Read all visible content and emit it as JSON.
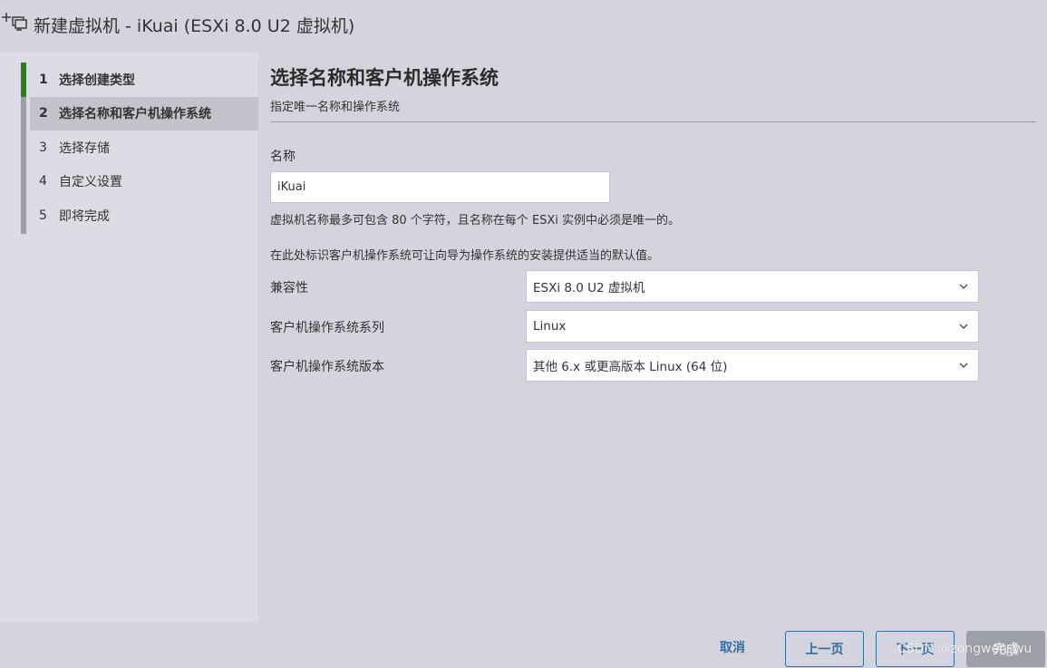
{
  "window": {
    "title": "新建虚拟机 - iKuai (ESXi 8.0 U2 虚拟机)",
    "icon": "new-vm-icon"
  },
  "steps": [
    {
      "num": "1",
      "label": "选择创建类型",
      "state": "done"
    },
    {
      "num": "2",
      "label": "选择名称和客户机操作系统",
      "state": "active"
    },
    {
      "num": "3",
      "label": "选择存储",
      "state": "pending"
    },
    {
      "num": "4",
      "label": "自定义设置",
      "state": "pending"
    },
    {
      "num": "5",
      "label": "即将完成",
      "state": "pending"
    }
  ],
  "page": {
    "title": "选择名称和客户机操作系统",
    "subtitle": "指定唯一名称和操作系统"
  },
  "name_field": {
    "label": "名称",
    "value": "iKuai",
    "hint": "虚拟机名称最多可包含 80 个字符，且名称在每个 ESXi 实例中必须是唯一的。"
  },
  "guest_hint": "在此处标识客户机操作系统可让向导为操作系统的安装提供适当的默认值。",
  "fields": [
    {
      "label": "兼容性",
      "value": "ESXi 8.0 U2 虚拟机"
    },
    {
      "label": "客户机操作系统系列",
      "value": "Linux"
    },
    {
      "label": "客户机操作系统版本",
      "value": "其他 6.x 或更高版本 Linux (64 位)"
    }
  ],
  "footer": {
    "cancel": "取消",
    "prev": "上一页",
    "next": "下一页",
    "finish": "完成"
  },
  "watermark": "CSDN @zongwen_wu",
  "colors": {
    "background": "#d4d4de",
    "sidebar": "#dcdce4",
    "active_step": "#c3c3cb",
    "progress_accent": "#2e7d1f",
    "link_blue": "#2f6fa3"
  }
}
